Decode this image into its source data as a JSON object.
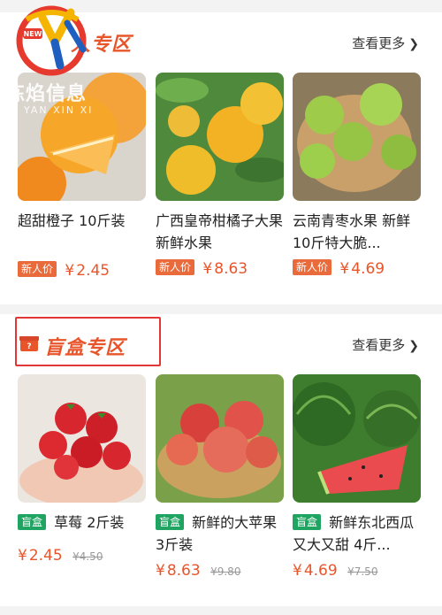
{
  "new_section": {
    "title": "人专区",
    "more": "查看更多",
    "products": [
      {
        "name": "超甜橙子 10斤装",
        "badge": "新人价",
        "price": "2.45"
      },
      {
        "name": "广西皇帝柑橘子大果新鲜水果",
        "badge": "新人价",
        "price": "8.63"
      },
      {
        "name": "云南青枣水果 新鲜10斤特大脆...",
        "badge": "新人价",
        "price": "4.69"
      }
    ]
  },
  "blind_section": {
    "title": "盲盒专区",
    "more": "查看更多",
    "products": [
      {
        "badge": "盲盒",
        "name": "草莓 2斤装",
        "price": "2.45",
        "old_price": "¥4.50"
      },
      {
        "badge": "盲盒",
        "name": "新鲜的大苹果 3斤装",
        "price": "8.63",
        "old_price": "¥9.80"
      },
      {
        "badge": "盲盒",
        "name": "新鲜东北西瓜又大又甜 4斤...",
        "price": "4.69",
        "old_price": "¥7.50"
      }
    ]
  },
  "currency": "¥",
  "watermark": {
    "main": "炼焰信息",
    "sub": "HI YAN XIN XI"
  },
  "logo_text": "NEW",
  "colors": {
    "accent": "#e8552b",
    "new_badge": "#e96a3b",
    "blind_badge": "#1fa462",
    "highlight": "#e33636"
  },
  "icons": [
    "chevron-right-icon",
    "gift-box-icon",
    "brand-logo"
  ]
}
